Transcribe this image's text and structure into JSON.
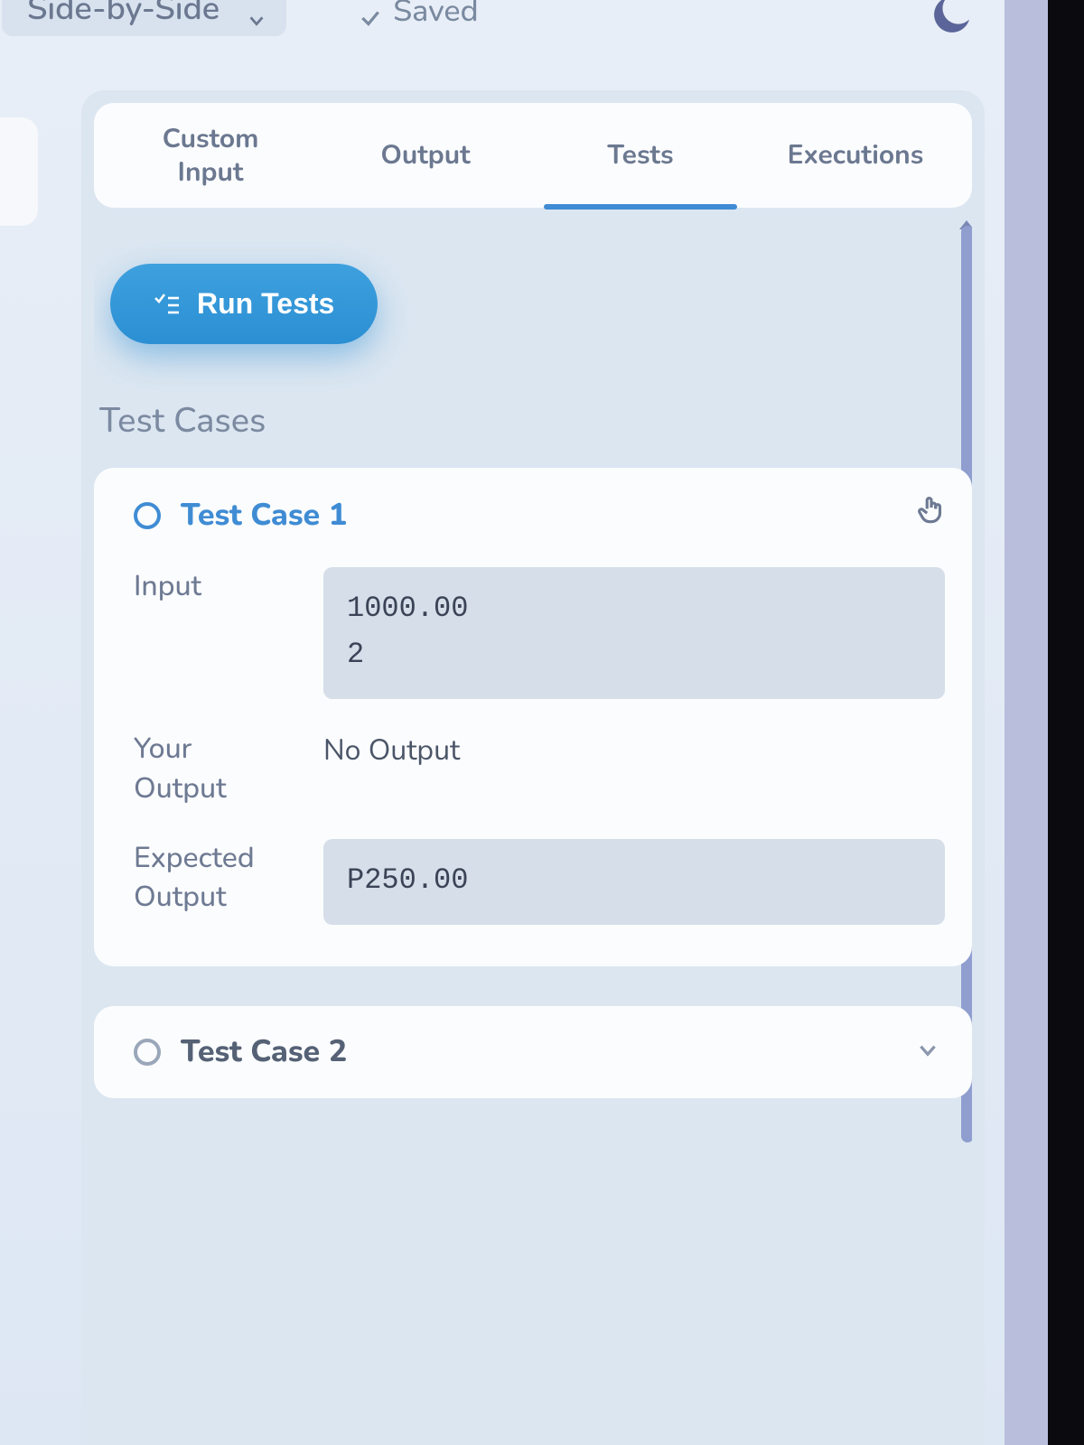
{
  "topbar": {
    "view_mode": "Side-by-Side",
    "saved_label": "Saved"
  },
  "tabs": {
    "custom_input": "Custom\nInput",
    "output": "Output",
    "tests": "Tests",
    "executions": "Executions",
    "active": "tests"
  },
  "run_button": "Run Tests",
  "section_title": "Test Cases",
  "test_cases": [
    {
      "title": "Test Case 1",
      "input_label": "Input",
      "input_value": "1000.00\n2",
      "your_output_label": "Your\nOutput",
      "your_output_value": "No Output",
      "expected_label": "Expected\nOutput",
      "expected_value": "P250.00",
      "expanded": true
    },
    {
      "title": "Test Case 2",
      "expanded": false
    }
  ]
}
